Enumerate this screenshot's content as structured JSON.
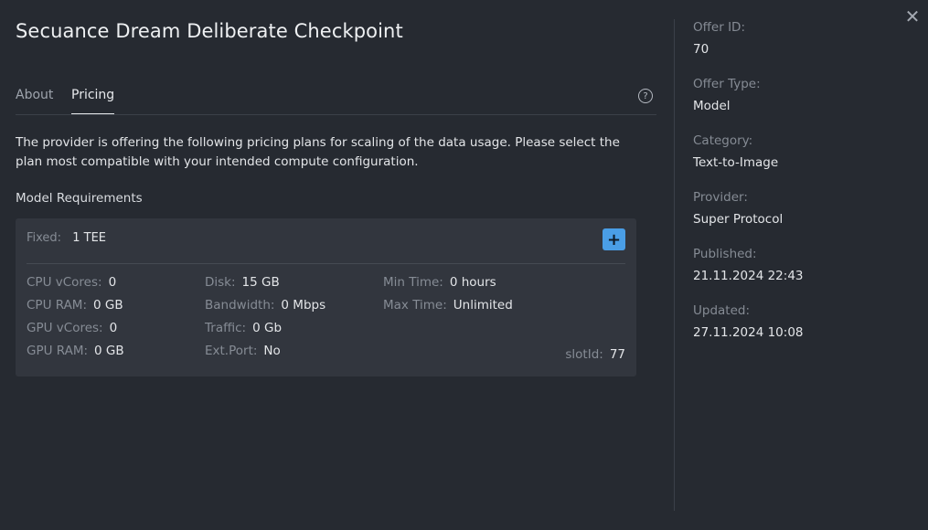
{
  "header": {
    "title": "Secuance Dream Deliberate Checkpoint"
  },
  "tabs": [
    {
      "label": "About"
    },
    {
      "label": "Pricing"
    }
  ],
  "description": "The provider is offering the following pricing plans for scaling of the data usage. Please select the plan most compatible with your intended compute configuration.",
  "requirements": {
    "title": "Model Requirements",
    "fixed_label": "Fixed:",
    "fixed_value": "1 TEE",
    "cpu_vcores": {
      "label": "CPU vCores:",
      "value": "0"
    },
    "cpu_ram": {
      "label": "CPU RAM:",
      "value": "0 GB"
    },
    "gpu_vcores": {
      "label": "GPU vCores:",
      "value": "0"
    },
    "gpu_ram": {
      "label": "GPU RAM:",
      "value": "0 GB"
    },
    "disk": {
      "label": "Disk:",
      "value": "15 GB"
    },
    "bandwidth": {
      "label": "Bandwidth:",
      "value": "0 Mbps"
    },
    "traffic": {
      "label": "Traffic:",
      "value": "0 Gb"
    },
    "ext_port": {
      "label": "Ext.Port:",
      "value": "No"
    },
    "min_time": {
      "label": "Min Time:",
      "value": "0 hours"
    },
    "max_time": {
      "label": "Max Time:",
      "value": "Unlimited"
    },
    "slot_id": {
      "label": "slotId:",
      "value": "77"
    }
  },
  "sidebar": {
    "offer_id": {
      "label": "Offer ID:",
      "value": "70"
    },
    "offer_type": {
      "label": "Offer Type:",
      "value": "Model"
    },
    "category": {
      "label": "Category:",
      "value": "Text-to-Image"
    },
    "provider": {
      "label": "Provider:",
      "value": "Super Protocol"
    },
    "published": {
      "label": "Published:",
      "value": "21.11.2024 22:43"
    },
    "updated": {
      "label": "Updated:",
      "value": "27.11.2024 10:08"
    }
  },
  "icons": {
    "close": "close-icon",
    "help": "question-circle-icon",
    "add": "plus-icon"
  },
  "colors": {
    "background": "#262a31",
    "card": "#32363e",
    "accent": "#4a9ee6"
  }
}
